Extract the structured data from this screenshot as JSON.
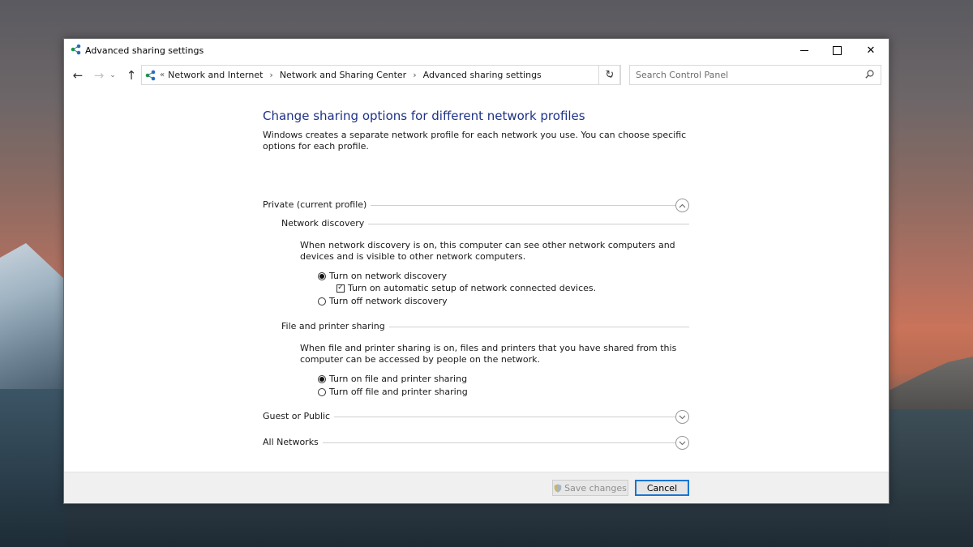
{
  "window": {
    "title": "Advanced sharing settings",
    "controls": {
      "minimize": "minimize",
      "maximize": "maximize",
      "close": "✕"
    }
  },
  "nav": {
    "back": "←",
    "forward": "→",
    "recent": "⌄",
    "up": "↑",
    "overflow": "«",
    "breadcrumbs": [
      "Network and Internet",
      "Network and Sharing Center",
      "Advanced sharing settings"
    ],
    "separator": "›",
    "dropdown": "⌄",
    "refresh": "↻",
    "search_placeholder": "Search Control Panel"
  },
  "main": {
    "heading": "Change sharing options for different network profiles",
    "intro": "Windows creates a separate network profile for each network you use. You can choose specific options for each profile.",
    "profiles": {
      "private": {
        "label": "Private (current profile)",
        "expanded": true,
        "network_discovery": {
          "label": "Network discovery",
          "description": "When network discovery is on, this computer can see other network computers and devices and is visible to other network computers.",
          "option_on": "Turn on network discovery",
          "option_auto_setup": "Turn on automatic setup of network connected devices.",
          "auto_setup_checkmark": "✓",
          "option_off": "Turn off network discovery",
          "selected": "on",
          "auto_setup_checked": true
        },
        "file_printer_sharing": {
          "label": "File and printer sharing",
          "description": "When file and printer sharing is on, files and printers that you have shared from this computer can be accessed by people on the network.",
          "option_on": "Turn on file and printer sharing",
          "option_off": "Turn off file and printer sharing",
          "selected": "on"
        }
      },
      "guest_public": {
        "label": "Guest or Public",
        "expanded": false
      },
      "all_networks": {
        "label": "All Networks",
        "expanded": false
      }
    }
  },
  "footer": {
    "save_label": "Save changes",
    "save_enabled": false,
    "cancel_label": "Cancel"
  },
  "colors": {
    "heading": "#1e3287",
    "cancel_border": "#1975d2"
  }
}
